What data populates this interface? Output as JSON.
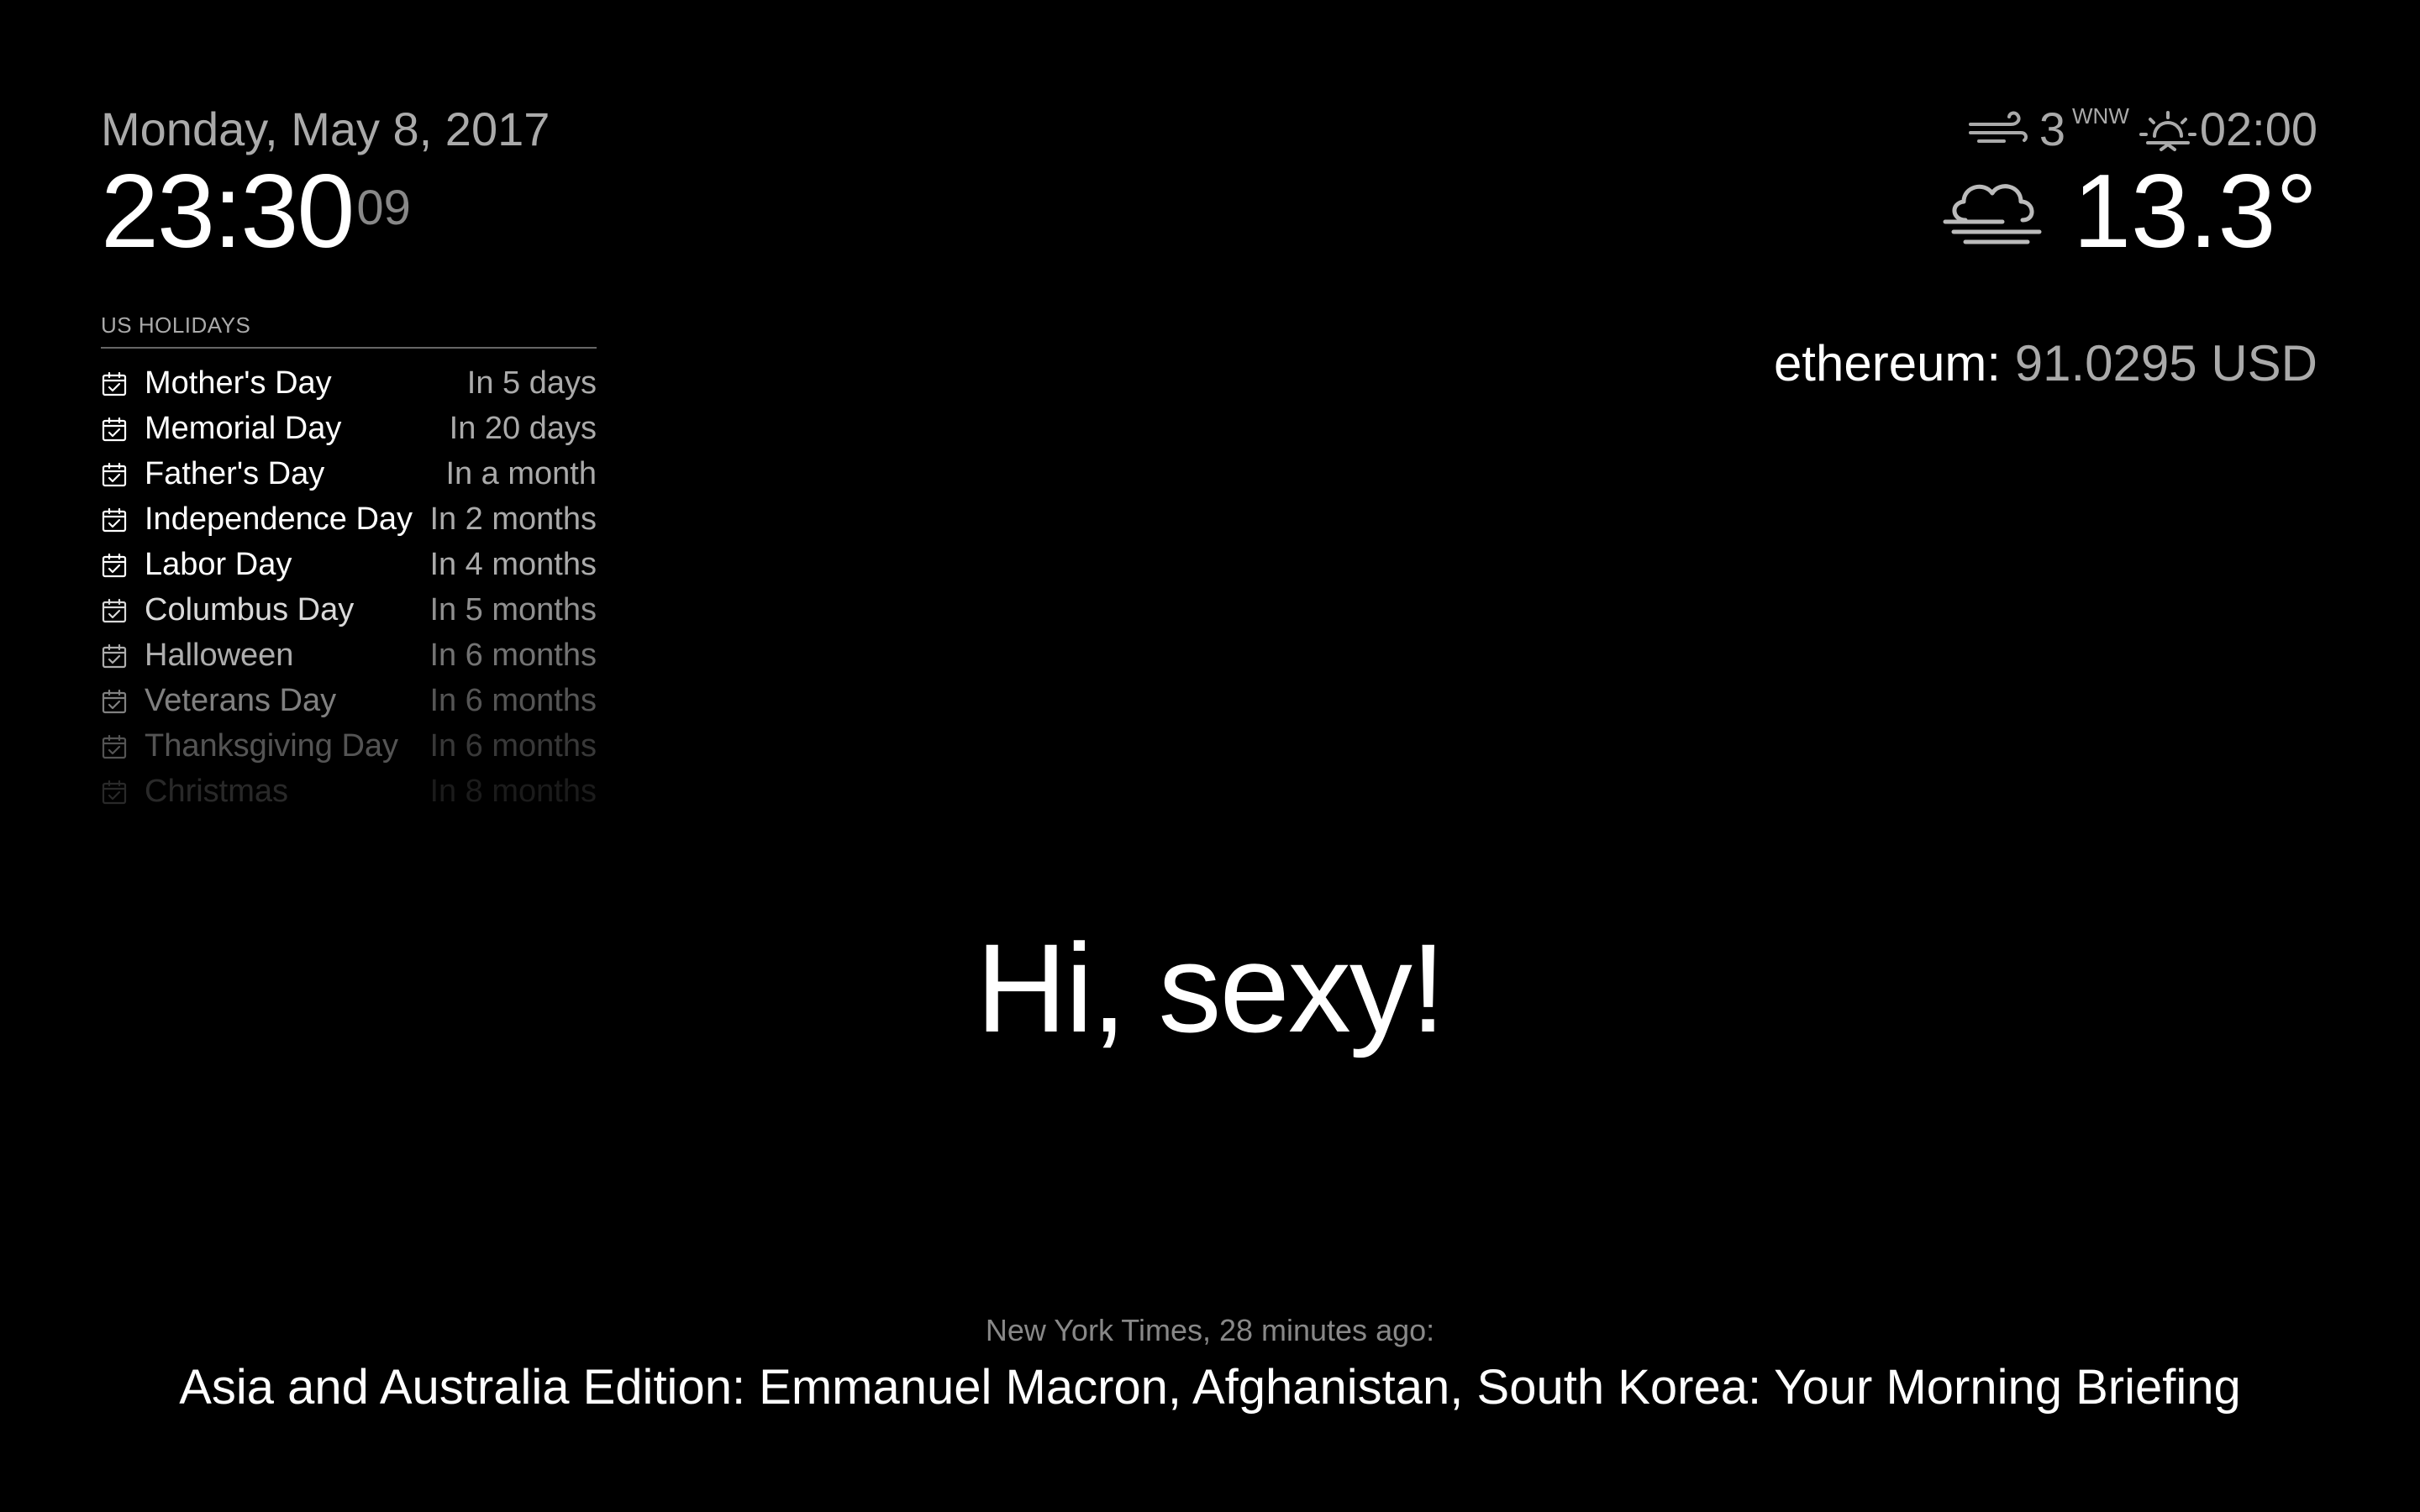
{
  "clock": {
    "date": "Monday, May 8, 2017",
    "hours_minutes": "23:30",
    "seconds": "09"
  },
  "calendar": {
    "header": "US HOLIDAYS",
    "icon": "calendar-check-icon",
    "events": [
      {
        "title": "Mother's Day",
        "when": "In 5 days",
        "opacity": 1.0
      },
      {
        "title": "Memorial Day",
        "when": "In 20 days",
        "opacity": 1.0
      },
      {
        "title": "Father's Day",
        "when": "In a month",
        "opacity": 1.0
      },
      {
        "title": "Independence Day",
        "when": "In 2 months",
        "opacity": 1.0
      },
      {
        "title": "Labor Day",
        "when": "In 4 months",
        "opacity": 1.0
      },
      {
        "title": "Columbus Day",
        "when": "In 5 months",
        "opacity": 0.85
      },
      {
        "title": "Halloween",
        "when": "In 6 months",
        "opacity": 0.68
      },
      {
        "title": "Veterans Day",
        "when": "In 6 months",
        "opacity": 0.5
      },
      {
        "title": "Thanksgiving Day",
        "when": "In 6 months",
        "opacity": 0.33
      },
      {
        "title": "Christmas",
        "when": "In 8 months",
        "opacity": 0.16
      }
    ]
  },
  "weather": {
    "wind_icon": "windy-icon",
    "wind_speed": "3",
    "wind_direction": "WNW",
    "sun_icon": "sunrise-icon",
    "sun_time": "02:00",
    "condition_icon": "cloudy-fog-icon",
    "temperature": "13.3°"
  },
  "crypto": {
    "coin_label": "ethereum:",
    "price": "91.0295 USD"
  },
  "compliment": {
    "text": "Hi, sexy!"
  },
  "news": {
    "source": "New York Times, 28 minutes ago:",
    "headline": "Asia and Australia Edition: Emmanuel Macron, Afghanistan, South Korea: Your Morning Briefing"
  },
  "colors": {
    "background": "#000000",
    "bright": "#ffffff",
    "normal": "#aaaaaa",
    "dimmed": "#888888"
  }
}
